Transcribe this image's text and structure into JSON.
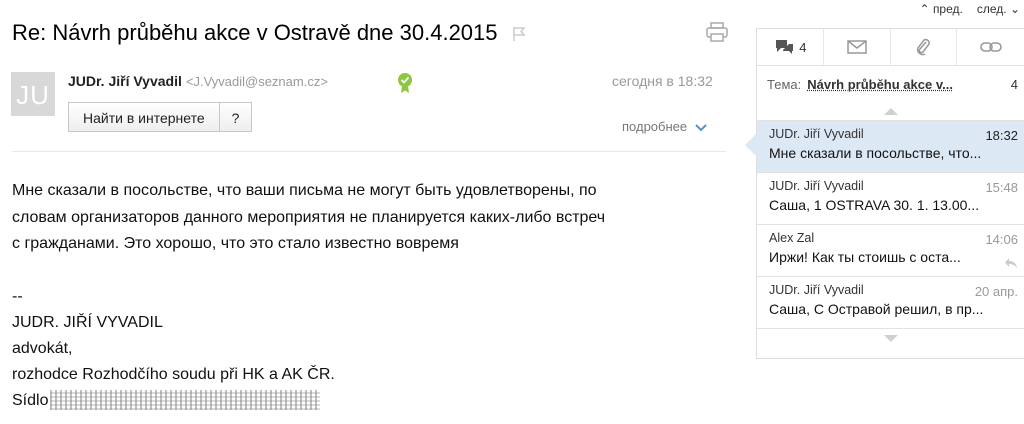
{
  "topnav": {
    "prev": "пред.",
    "next": "след."
  },
  "subject": "Re: Návrh průběhu akce v Ostravě dne 30.4.2015",
  "sender": {
    "avatar": "JU",
    "name": "JUDr. Jiří Vyvadil",
    "email": "<J.Vyvadil@seznam.cz>",
    "date": "сегодня в 18:32"
  },
  "buttons": {
    "find": "Найти в интернете",
    "help": "?"
  },
  "more": "подробнее",
  "body": {
    "line1": "Мне сказали в посольстве, что ваши письма не могут быть удовлетворены, по",
    "line2": "словам организаторов данного мероприятия не планируется каких-либо встреч",
    "line3": "с гражданами. Это хорошо, что это стало известно вовремя",
    "sig_dash": "--",
    "sig_name": "JUDR. JIŘÍ VYVADIL",
    "sig_title": "advokát,",
    "sig_role": "rozhodce Rozhodčího soudu při HK a AK ČR.",
    "sig_seat": "Sídlo"
  },
  "panel": {
    "thread_count": "4",
    "theme_label": "Тема:",
    "theme_value": "Návrh průběhu akce v...",
    "theme_count": "4",
    "messages": [
      {
        "from": "JUDr. Jiří Vyvadil",
        "time": "18:32",
        "snippet": "Мне сказали в посольстве, что..."
      },
      {
        "from": "JUDr. Jiří Vyvadil",
        "time": "15:48",
        "snippet": "Саша, 1 OSTRAVA 30. 1. 13.00..."
      },
      {
        "from": "Alex Zal",
        "time": "14:06",
        "snippet": "Иржи! Как ты стоишь с оста..."
      },
      {
        "from": "JUDr. Jiří Vyvadil",
        "time": "20 апр.",
        "snippet": "Саша, С Остравой решил, в пр..."
      }
    ]
  },
  "icons": [
    "flag-icon",
    "print-icon",
    "verified-icon",
    "chevron-down-icon",
    "thread-icon",
    "mail-icon",
    "attachment-icon",
    "link-icon",
    "reply-icon"
  ],
  "colors": {
    "active": "#dde8f5",
    "verified": "#8dc63f"
  }
}
